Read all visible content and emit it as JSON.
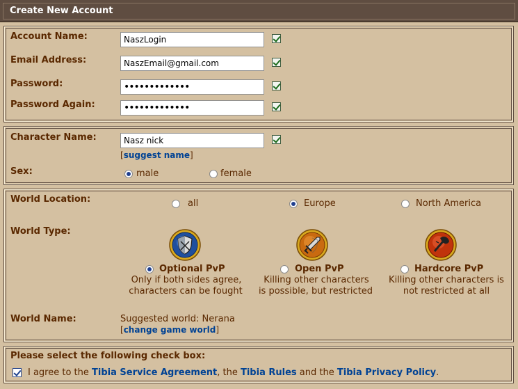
{
  "header": {
    "title": "Create New Account"
  },
  "account": {
    "account_name_label": "Account Name:",
    "account_name_value": "NaszLogin",
    "email_label": "Email Address:",
    "email_value": "NaszEmail@gmail.com",
    "password_label": "Password:",
    "password_value": "•••••••••••••",
    "password_again_label": "Password Again:",
    "password_again_value": "•••••••••••••"
  },
  "character": {
    "name_label": "Character Name:",
    "name_value": "Nasz nick",
    "suggest_open": "[",
    "suggest_link": "suggest name",
    "suggest_close": "]",
    "sex_label": "Sex:",
    "sex_options": [
      "male",
      "female"
    ],
    "sex_selected": "male"
  },
  "world": {
    "location_label": "World Location:",
    "location_options": [
      "all",
      "Europe",
      "North America"
    ],
    "location_selected": "Europe",
    "type_label": "World Type:",
    "types": [
      {
        "name": "Optional PvP",
        "desc1": "Only if both sides agree,",
        "desc2": "characters can be fought",
        "color": "#2f5fae",
        "icon": "shield-icon"
      },
      {
        "name": "Open PvP",
        "desc1": "Killing other characters",
        "desc2": "is possible, but restricted",
        "color": "#c86a10",
        "icon": "sword-icon"
      },
      {
        "name": "Hardcore PvP",
        "desc1": "Killing other characters is",
        "desc2": "not restricted at all",
        "color": "#c0330c",
        "icon": "axe-icon"
      }
    ],
    "type_selected": "Optional PvP",
    "name_label": "World Name:",
    "suggested_text": "Suggested world: Nerana",
    "change_open": "[",
    "change_link": "change game world",
    "change_close": "]"
  },
  "agreement": {
    "heading": "Please select the following check box:",
    "text_1": "I agree to the",
    "link_1": "Tibia Service Agreement",
    "text_2": ", the",
    "link_2": "Tibia Rules",
    "text_3": "and the",
    "link_3": "Tibia Privacy Policy",
    "text_4": ".",
    "checked": true
  },
  "colors": {
    "header_bg": "#5f4d41",
    "panel_bg": "#d4c0a1",
    "label": "#5a2800",
    "link": "#004294"
  }
}
